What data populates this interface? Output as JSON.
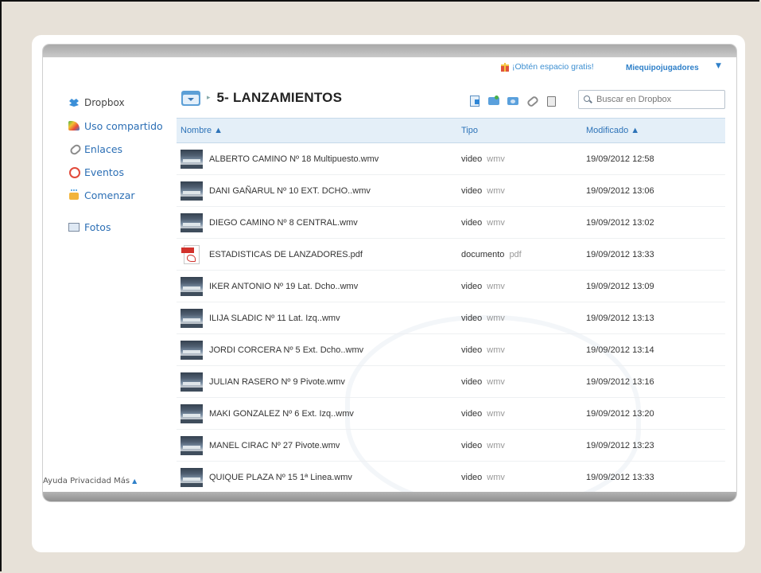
{
  "colors": {
    "link": "#2c6fb5",
    "header_bg": "#e4eff8",
    "accent_red": "#d2322c"
  },
  "top": {
    "promo": "¡Obtén espacio gratis!",
    "user": "Miequipojugadores",
    "user_caret": "▼"
  },
  "sidebar": {
    "items": [
      {
        "label": "Dropbox",
        "icon": "dropbox-logo-icon"
      },
      {
        "label": "Uso compartido",
        "icon": "shared-icon"
      },
      {
        "label": "Enlaces",
        "icon": "link-icon"
      },
      {
        "label": "Eventos",
        "icon": "events-icon"
      },
      {
        "label": "Comenzar",
        "icon": "get-started-icon"
      },
      {
        "label": "Fotos",
        "icon": "photos-icon"
      }
    ],
    "footer": "Ayuda Privacidad Más",
    "footer_caret": "▲"
  },
  "folder": {
    "separator": "▸",
    "title": "5- LANZAMIENTOS"
  },
  "search": {
    "placeholder": "Buscar en Dropbox"
  },
  "table": {
    "headers": {
      "name": "Nombre ▲",
      "type": "Tipo",
      "modified": "Modificado ▲"
    },
    "rows": [
      {
        "name": "ALBERTO CAMINO Nº 18 Multipuesto.wmv",
        "kind": "video",
        "ext": "wmv",
        "modified": "19/09/2012 12:58"
      },
      {
        "name": "DANI GAÑARUL Nº 10 EXT. DCHO..wmv",
        "kind": "video",
        "ext": "wmv",
        "modified": "19/09/2012 13:06"
      },
      {
        "name": "DIEGO CAMINO Nº 8 CENTRAL.wmv",
        "kind": "video",
        "ext": "wmv",
        "modified": "19/09/2012 13:02"
      },
      {
        "name": "ESTADISTICAS DE LANZADORES.pdf",
        "kind": "documento",
        "ext": "pdf",
        "modified": "19/09/2012 13:33"
      },
      {
        "name": "IKER ANTONIO Nº 19 Lat. Dcho..wmv",
        "kind": "video",
        "ext": "wmv",
        "modified": "19/09/2012 13:09"
      },
      {
        "name": "ILIJA SLADIC Nº 11 Lat. Izq..wmv",
        "kind": "video",
        "ext": "wmv",
        "modified": "19/09/2012 13:13"
      },
      {
        "name": "JORDI CORCERA Nº 5 Ext. Dcho..wmv",
        "kind": "video",
        "ext": "wmv",
        "modified": "19/09/2012 13:14"
      },
      {
        "name": "JULIAN RASERO Nº 9 Pivote.wmv",
        "kind": "video",
        "ext": "wmv",
        "modified": "19/09/2012 13:16"
      },
      {
        "name": "MAKI GONZALEZ Nº 6 Ext. Izq..wmv",
        "kind": "video",
        "ext": "wmv",
        "modified": "19/09/2012 13:20"
      },
      {
        "name": "MANEL CIRAC Nº 27 Pivote.wmv",
        "kind": "video",
        "ext": "wmv",
        "modified": "19/09/2012 13:23"
      },
      {
        "name": "QUIQUE PLAZA Nº 15 1ª Linea.wmv",
        "kind": "video",
        "ext": "wmv",
        "modified": "19/09/2012 13:33"
      }
    ]
  }
}
